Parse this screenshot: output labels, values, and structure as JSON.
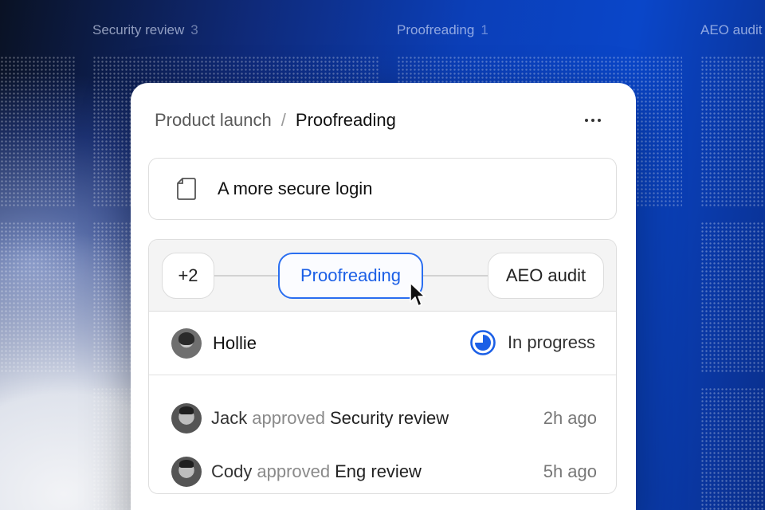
{
  "board": {
    "columns": [
      {
        "label": "Security review",
        "count": "3"
      },
      {
        "label": "Proofreading",
        "count": "1"
      },
      {
        "label": "AEO audit",
        "count": ""
      }
    ]
  },
  "card": {
    "breadcrumb": {
      "parent": "Product launch",
      "separator": "/",
      "current": "Proofreading"
    },
    "more_icon": "more-horizontal-icon",
    "document": {
      "icon": "document-icon",
      "title": "A more secure login"
    },
    "stages": {
      "more": "+2",
      "active": "Proofreading",
      "next": "AEO audit"
    },
    "assignee": {
      "name": "Hollie",
      "status": "In progress",
      "status_color": "#1b5fe6"
    },
    "activity": [
      {
        "actor": "Jack",
        "verb": "approved",
        "target": "Security review",
        "time": "2h ago"
      },
      {
        "actor": "Cody",
        "verb": "approved",
        "target": "Eng review",
        "time": "5h ago"
      }
    ]
  },
  "colors": {
    "accent": "#2a6ef0",
    "background": "#0b3fb8"
  }
}
